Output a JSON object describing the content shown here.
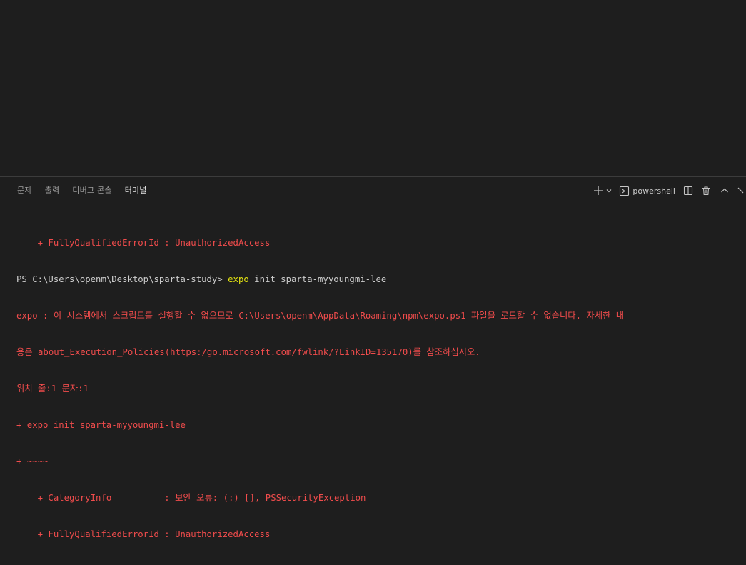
{
  "panel": {
    "tabs": [
      {
        "label": "문제"
      },
      {
        "label": "출력"
      },
      {
        "label": "디버그 콘솔"
      },
      {
        "label": "터미널"
      }
    ],
    "active_tab": "터미널",
    "shell_name": "powershell",
    "icons": {
      "new_terminal": "plus-icon",
      "dropdown": "chevron-down-icon",
      "shell": "terminal-icon",
      "split": "split-icon",
      "kill": "trash-icon",
      "maximize": "chevron-up-icon",
      "close": "close-icon"
    }
  },
  "terminal": {
    "lines": [
      {
        "text": "    + FullyQualifiedErrorId : UnauthorizedAccess"
      },
      {
        "prompt": "PS C:\\Users\\openm\\Desktop\\sparta-study> ",
        "cmd": "expo",
        "args": " init sparta-myyoungmi-lee"
      },
      {
        "text": "expo : 이 시스템에서 스크립트를 실행할 수 없으므로 C:\\Users\\openm\\AppData\\Roaming\\npm\\expo.ps1 파일을 로드할 수 없습니다. 자세한 내"
      },
      {
        "text": "용은 about_Execution_Policies(https:/go.microsoft.com/fwlink/?LinkID=135170)를 참조하십시오."
      },
      {
        "text": "위치 줄:1 문자:1"
      },
      {
        "text": "+ expo init sparta-myyoungmi-lee"
      },
      {
        "text": "+ ~~~~"
      },
      {
        "text": "    + CategoryInfo          : 보안 오류: (:) [], PSSecurityException"
      },
      {
        "text": "    + FullyQualifiedErrorId : UnauthorizedAccess"
      }
    ]
  },
  "colors": {
    "background": "#1e1e1e",
    "error_red": "#f14c4c",
    "command_yellow": "#e5e510",
    "text": "#cccccc"
  }
}
